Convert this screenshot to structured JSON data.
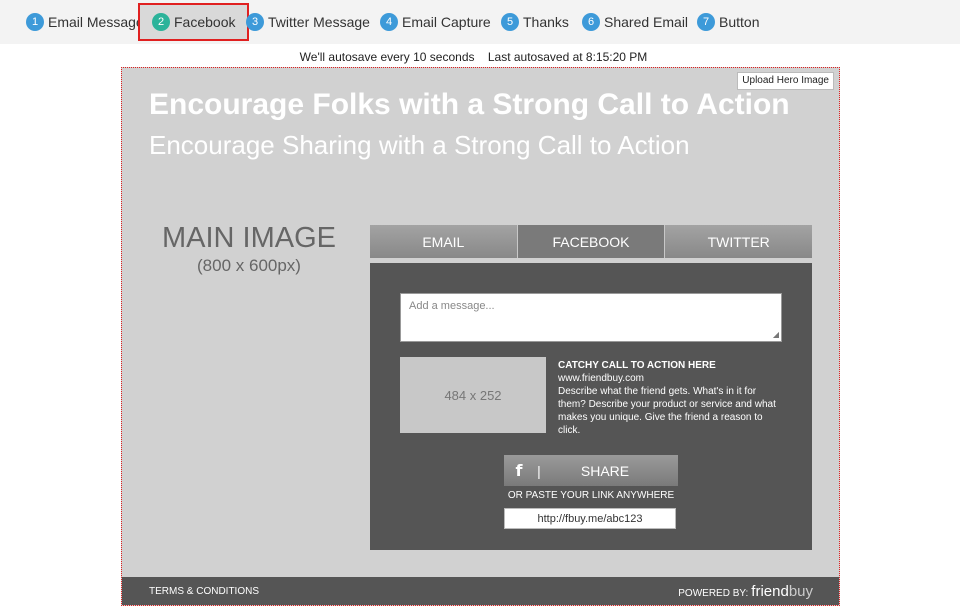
{
  "steps": [
    {
      "num": "1",
      "label": "Email Message"
    },
    {
      "num": "2",
      "label": "Facebook"
    },
    {
      "num": "3",
      "label": "Twitter Message"
    },
    {
      "num": "4",
      "label": "Email Capture"
    },
    {
      "num": "5",
      "label": "Thanks"
    },
    {
      "num": "6",
      "label": "Shared Email"
    },
    {
      "num": "7",
      "label": "Button"
    }
  ],
  "autosave": {
    "interval_text": "We'll autosave every 10 seconds",
    "last_text": "Last autosaved at 8:15:20 PM"
  },
  "canvas": {
    "upload_label": "Upload Hero Image",
    "title": "Encourage Folks with a Strong Call to Action",
    "subtitle": "Encourage Sharing with a Strong Call to Action",
    "main_image": {
      "label": "MAIN IMAGE",
      "size": "(800 x 600px)"
    },
    "tabs": [
      "EMAIL",
      "FACEBOOK",
      "TWITTER"
    ],
    "active_tab": "FACEBOOK",
    "panel": {
      "message_placeholder": "Add a message...",
      "image_placeholder": "484 x 252",
      "cta_heading": "CATCHY CALL TO ACTION HERE",
      "url": "www.friendbuy.com",
      "description": "Describe what the friend gets. What's in it for them? Describe your product or service and what makes you unique. Give the friend a reason to click.",
      "share_icon": "f",
      "share_sep": "|",
      "share_label": "SHARE",
      "paste_label": "OR PASTE YOUR LINK ANYWHERE",
      "link": "http://fbuy.me/abc123"
    },
    "footer": {
      "terms": "TERMS & CONDITIONS",
      "powered": "POWERED BY:",
      "brand_a": "friend",
      "brand_b": "buy"
    }
  },
  "colors": {
    "step_badge": "#3d9ad9",
    "step_badge_active": "#2bb39a",
    "highlight_border": "#e02020",
    "canvas_bg": "#d1d1d1",
    "panel_bg": "#555555"
  }
}
